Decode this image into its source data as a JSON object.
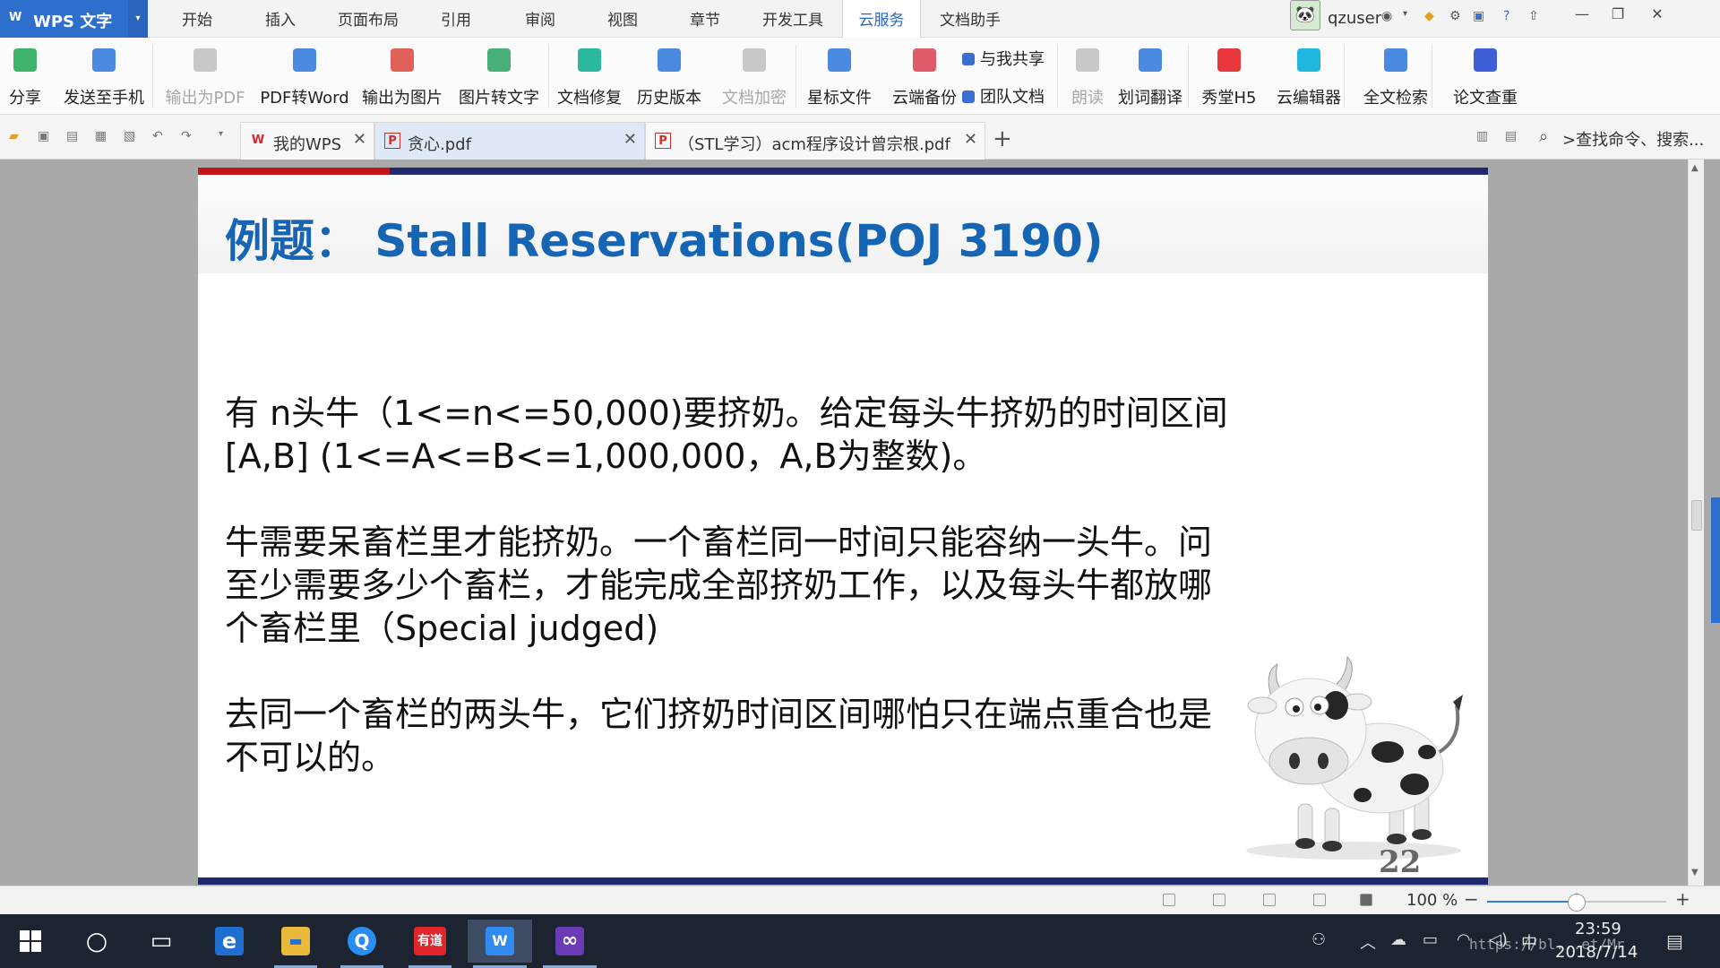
{
  "app": {
    "logo": "W",
    "name": "WPS 文字",
    "dropdown": "▾"
  },
  "menu": {
    "tabs": [
      {
        "label": "开始"
      },
      {
        "label": "插入"
      },
      {
        "label": "页面布局"
      },
      {
        "label": "引用"
      },
      {
        "label": "审阅"
      },
      {
        "label": "视图"
      },
      {
        "label": "章节"
      },
      {
        "label": "开发工具"
      },
      {
        "label": "云服务",
        "active": true
      },
      {
        "label": "文档助手"
      }
    ]
  },
  "user": {
    "name": "qzuser"
  },
  "ribbon": {
    "buttons": [
      {
        "label": "分享",
        "icon": "share-icon",
        "color": "#3fb36b"
      },
      {
        "label": "发送至手机",
        "icon": "phone-icon",
        "color": "#4a8ae0"
      },
      {
        "label": "输出为PDF",
        "icon": "pdf-export-icon",
        "color": "#c8c8c8",
        "disabled": true
      },
      {
        "label": "PDF转Word",
        "icon": "pdf-to-word-icon",
        "color": "#4a8ae0"
      },
      {
        "label": "输出为图片",
        "icon": "image-export-icon",
        "color": "#e0605a"
      },
      {
        "label": "图片转文字",
        "icon": "image-to-text-icon",
        "color": "#4ab07a"
      },
      {
        "label": "文档修复",
        "icon": "repair-icon",
        "color": "#2bb7a0"
      },
      {
        "label": "历史版本",
        "icon": "history-icon",
        "color": "#4a8ae0"
      },
      {
        "label": "文档加密",
        "icon": "encrypt-icon",
        "color": "#c8c8c8",
        "disabled": true
      },
      {
        "label": "星标文件",
        "icon": "star-folder-icon",
        "color": "#4a8ae0"
      },
      {
        "label": "云端备份",
        "icon": "cloud-backup-icon",
        "color": "#e05a6a"
      },
      {
        "label": "朗读",
        "icon": "microphone-icon",
        "color": "#c8c8c8",
        "disabled": true
      },
      {
        "label": "划词翻译",
        "icon": "translate-icon",
        "color": "#4a8ae0"
      },
      {
        "label": "秀堂H5",
        "icon": "h5-icon",
        "color": "#e8383d"
      },
      {
        "label": "云编辑器",
        "icon": "cloud-editor-icon",
        "color": "#1fb6e0"
      },
      {
        "label": "全文检索",
        "icon": "search-doc-icon",
        "color": "#4a8ae0"
      },
      {
        "label": "论文查重",
        "icon": "paper-check-icon",
        "color": "#3f5fd8"
      }
    ],
    "mini": [
      {
        "label": "与我共享",
        "icon": "shared-with-me-icon"
      },
      {
        "label": "团队文档",
        "icon": "team-docs-icon"
      }
    ]
  },
  "tabs": [
    {
      "label": "我的WPS",
      "icon": "wps-home-icon",
      "icon_text": "W",
      "color": "#d9262c"
    },
    {
      "label": "贪心.pdf",
      "icon": "pdf-file-icon",
      "icon_text": "P",
      "color": "#c9302c",
      "active": true
    },
    {
      "label": "（STL学习）acm程序设计曾宗根.pdf",
      "icon": "pdf-file-icon",
      "icon_text": "P",
      "color": "#c9302c"
    }
  ],
  "toolbar": {
    "new_tab": "+",
    "command_search": ">查找命令、搜索..."
  },
  "slide": {
    "title": "例题： Stall Reservations(POJ 3190)",
    "paragraphs": [
      "有 n头牛（1<=n<=50,000)要挤奶。给定每头牛挤奶的时间区间[A,B] (1<=A<=B<=1,000,000，A,B为整数)。",
      "牛需要呆畜栏里才能挤奶。一个畜栏同一时间只能容纳一头牛。问至少需要多少个畜栏，才能完成全部挤奶工作，以及每头牛都放哪个畜栏里（Special judged)",
      "去同一个畜栏的两头牛，它们挤奶时间区间哪怕只在端点重合也是不可以的。"
    ],
    "page_number": "22"
  },
  "status": {
    "zoom": "100 %",
    "zoom_value": 0.5,
    "zoom_minus": "−",
    "zoom_plus": "+"
  },
  "taskbar": {
    "apps": [
      {
        "name": "cortana",
        "glyph": "○",
        "color": "transparent"
      },
      {
        "name": "task-view",
        "glyph": "▭",
        "color": "transparent"
      },
      {
        "name": "edge",
        "glyph": "e",
        "color": "#1f6fd0"
      },
      {
        "name": "file-explorer",
        "glyph": "▬",
        "color": "#e8b93a"
      },
      {
        "name": "qq-browser",
        "glyph": "Q",
        "color": "#2a8ef0"
      },
      {
        "name": "youdao",
        "glyph": "有道",
        "color": "#e0262b"
      },
      {
        "name": "wps",
        "glyph": "W",
        "color": "#2f8bf0",
        "active": true
      },
      {
        "name": "visual-studio",
        "glyph": "∞",
        "color": "#6a3bb5"
      }
    ],
    "ime": "中",
    "time": "23:59",
    "date": "2018/7/14",
    "watermark": "https://bl...et/Mr"
  }
}
